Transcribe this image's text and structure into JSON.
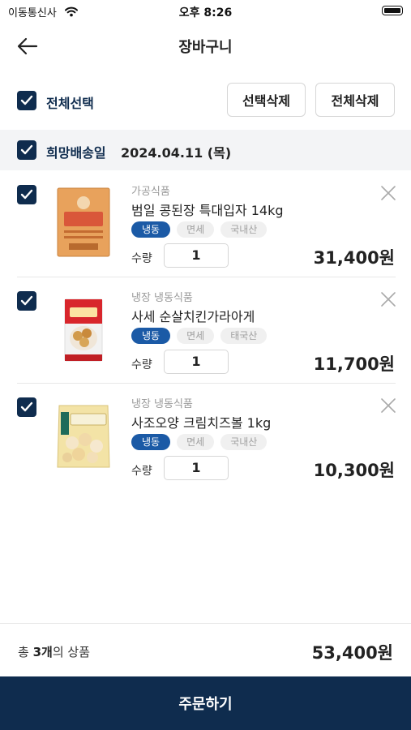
{
  "status": {
    "carrier": "이동통신사",
    "time": "오후 8:26"
  },
  "nav": {
    "title": "장바구니"
  },
  "select": {
    "all_label": "전체선택",
    "delete_selected": "선택삭제",
    "delete_all": "전체삭제"
  },
  "delivery": {
    "label": "희망배송일",
    "date": "2024.04.11 (목)"
  },
  "items": [
    {
      "category": "가공식품",
      "name": "범일 콩된장 특대입자 14kg",
      "tags": [
        "냉동",
        "면세",
        "국내산"
      ],
      "qty_label": "수량",
      "qty": "1",
      "price": "31,400원",
      "image": "doenjang-bag"
    },
    {
      "category": "냉장 냉동식품",
      "name": "사세 순살치킨가라아게",
      "tags": [
        "냉동",
        "면세",
        "태국산"
      ],
      "qty_label": "수량",
      "qty": "1",
      "price": "11,700원",
      "image": "chicken-pack"
    },
    {
      "category": "냉장 냉동식품",
      "name": "사조오양 크림치즈볼 1kg",
      "tags": [
        "냉동",
        "면세",
        "국내산"
      ],
      "qty_label": "수량",
      "qty": "1",
      "price": "10,300원",
      "image": "cheeseball-bag"
    }
  ],
  "total": {
    "prefix": "총",
    "count": "3개",
    "suffix": "의 상품",
    "price": "53,400원"
  },
  "order": {
    "label": "주문하기"
  },
  "colors": {
    "primary": "#0f2c4e",
    "tag_accent": "#1b5aa6",
    "date_bar_bg": "#f3f4f6"
  }
}
